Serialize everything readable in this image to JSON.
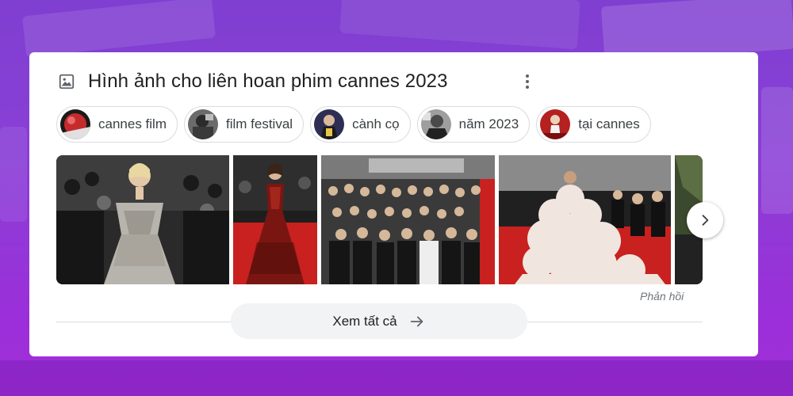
{
  "panel": {
    "title": "Hình ảnh cho liên hoan phim cannes 2023",
    "title_icon": "image-icon",
    "more_icon": "more-vert-icon"
  },
  "chips": [
    {
      "label": "cannes film",
      "thumb_color": "#c62b2b"
    },
    {
      "label": "film festival",
      "thumb_color": "#4a4a4a"
    },
    {
      "label": "cành cọ",
      "thumb_color": "#3b3b6e"
    },
    {
      "label": "năm 2023",
      "thumb_color": "#777777"
    },
    {
      "label": "tại cannes",
      "thumb_color": "#b52020"
    }
  ],
  "gallery": {
    "next_icon": "chevron-right-icon",
    "feedback": "Phản hồi"
  },
  "see_all": {
    "label": "Xem tất cả",
    "icon": "arrow-right-icon"
  },
  "colors": {
    "background": "#8a3fd6",
    "card": "#ffffff",
    "red_carpet": "#c8211f"
  }
}
